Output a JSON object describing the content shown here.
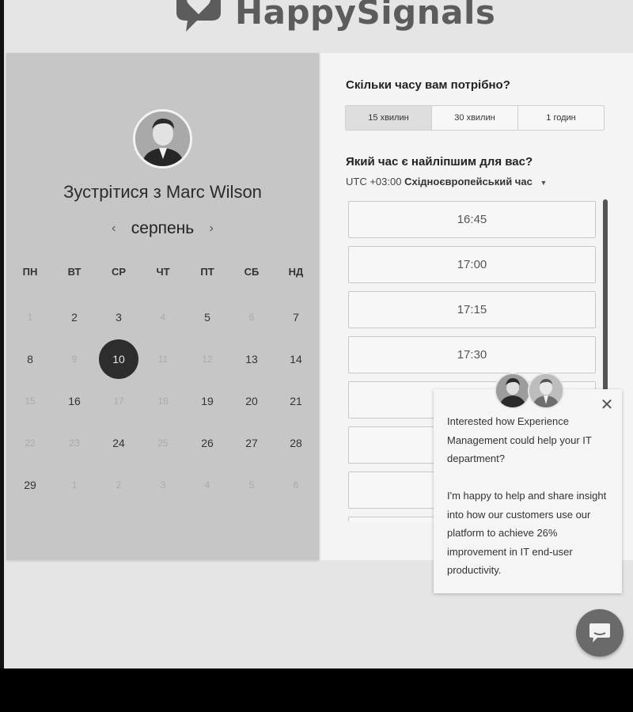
{
  "header": {
    "logo_text": "HappySignals"
  },
  "scheduler": {
    "meet_title": "Зустрітися з Marc Wilson",
    "month": "серпень",
    "weekdays": [
      "ПН",
      "ВТ",
      "СР",
      "ЧТ",
      "ПТ",
      "СБ",
      "НД"
    ],
    "days": [
      {
        "d": "1",
        "muted": true
      },
      {
        "d": "2",
        "muted": false
      },
      {
        "d": "3",
        "muted": false
      },
      {
        "d": "4",
        "muted": true
      },
      {
        "d": "5",
        "muted": false
      },
      {
        "d": "6",
        "muted": true
      },
      {
        "d": "7",
        "muted": false
      },
      {
        "d": "8",
        "muted": false
      },
      {
        "d": "9",
        "muted": true
      },
      {
        "d": "10",
        "muted": false,
        "selected": true
      },
      {
        "d": "11",
        "muted": true
      },
      {
        "d": "12",
        "muted": true
      },
      {
        "d": "13",
        "muted": false
      },
      {
        "d": "14",
        "muted": false
      },
      {
        "d": "15",
        "muted": true
      },
      {
        "d": "16",
        "muted": false
      },
      {
        "d": "17",
        "muted": true
      },
      {
        "d": "18",
        "muted": true
      },
      {
        "d": "19",
        "muted": false
      },
      {
        "d": "20",
        "muted": false
      },
      {
        "d": "21",
        "muted": false
      },
      {
        "d": "22",
        "muted": true
      },
      {
        "d": "23",
        "muted": true
      },
      {
        "d": "24",
        "muted": false
      },
      {
        "d": "25",
        "muted": true
      },
      {
        "d": "26",
        "muted": false
      },
      {
        "d": "27",
        "muted": false
      },
      {
        "d": "28",
        "muted": false
      },
      {
        "d": "29",
        "muted": false
      },
      {
        "d": "1",
        "muted": true
      },
      {
        "d": "2",
        "muted": true
      },
      {
        "d": "3",
        "muted": true
      },
      {
        "d": "4",
        "muted": true
      },
      {
        "d": "5",
        "muted": true
      },
      {
        "d": "6",
        "muted": true
      }
    ]
  },
  "booking": {
    "duration_question": "Скільки часу вам потрібно?",
    "durations": [
      "15 хвилин",
      "30 хвилин",
      "1 годин"
    ],
    "selected_duration": "15 хвилин",
    "time_question": "Який час є найліпшим для вас?",
    "timezone_offset": "UTC +03:00",
    "timezone_name": "Східноєвропейський час",
    "slots": [
      "16:45",
      "17:00",
      "17:15",
      "17:30",
      "",
      "",
      "",
      ""
    ]
  },
  "chat": {
    "message_1": "Interested how Experience Management could help your IT department?",
    "message_2": "I'm happy to help and share insight into how our customers use our platform to achieve 26% improvement in IT end-user productivity.",
    "close_icon": "close-icon",
    "launcher_icon": "chat-bubble-icon"
  }
}
